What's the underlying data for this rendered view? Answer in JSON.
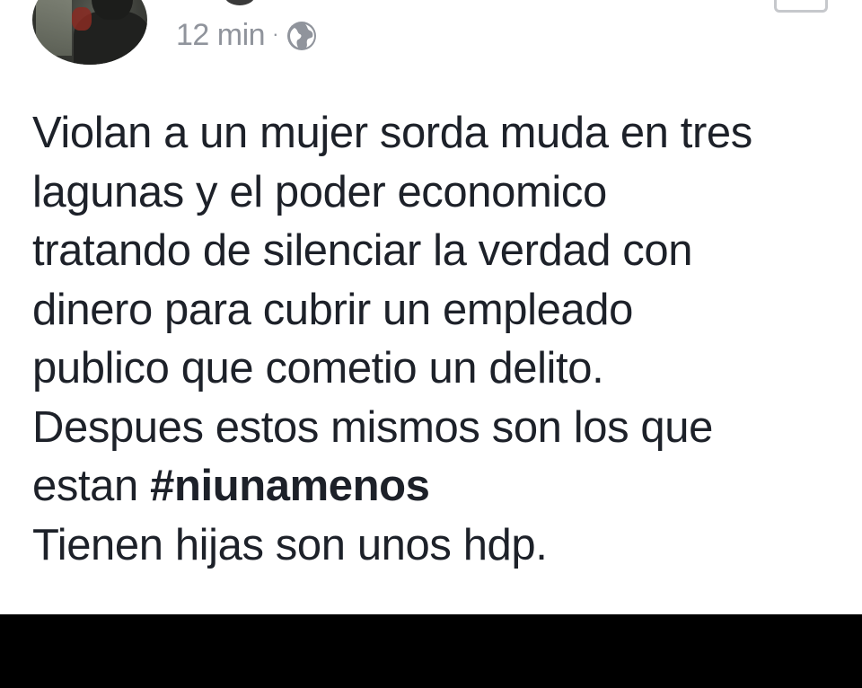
{
  "post": {
    "timestamp": "12 min",
    "separator": "·",
    "audience_icon": "globe-icon",
    "lines": [
      "Violan a un mujer sorda muda en tres",
      "lagunas y el poder economico",
      "tratando de silenciar la verdad con",
      "dinero para cubrir un empleado",
      "publico que cometio un delito.",
      "Despues estos mismos son los que"
    ],
    "line7_prefix": "estan ",
    "hashtag": "#niunamenos",
    "last_line": "Tienen hijas son unos hdp."
  },
  "colors": {
    "text": "#1d2129",
    "meta": "#90949c",
    "background": "#ffffff",
    "bottom_bar": "#000000"
  }
}
